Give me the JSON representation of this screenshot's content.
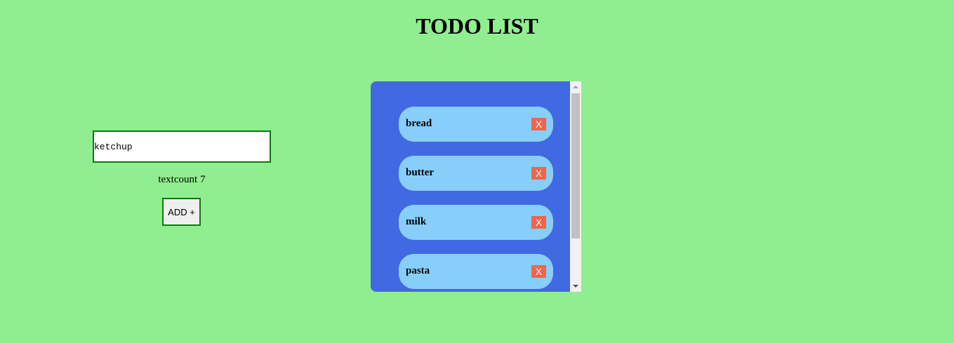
{
  "page": {
    "title": "TODO LIST"
  },
  "form": {
    "input_value": "ketchup",
    "textcount_label": "textcount",
    "textcount_value": "7",
    "add_button_label": "ADD +"
  },
  "todos": [
    {
      "label": "bread",
      "delete_label": "X"
    },
    {
      "label": "butter",
      "delete_label": "X"
    },
    {
      "label": "milk",
      "delete_label": "X"
    },
    {
      "label": "pasta",
      "delete_label": "X"
    }
  ],
  "colors": {
    "background": "#90ee90",
    "panel": "#4169e1",
    "item": "#87cefa",
    "delete_button": "#f0644a",
    "input_border": "#0a7a0a"
  }
}
